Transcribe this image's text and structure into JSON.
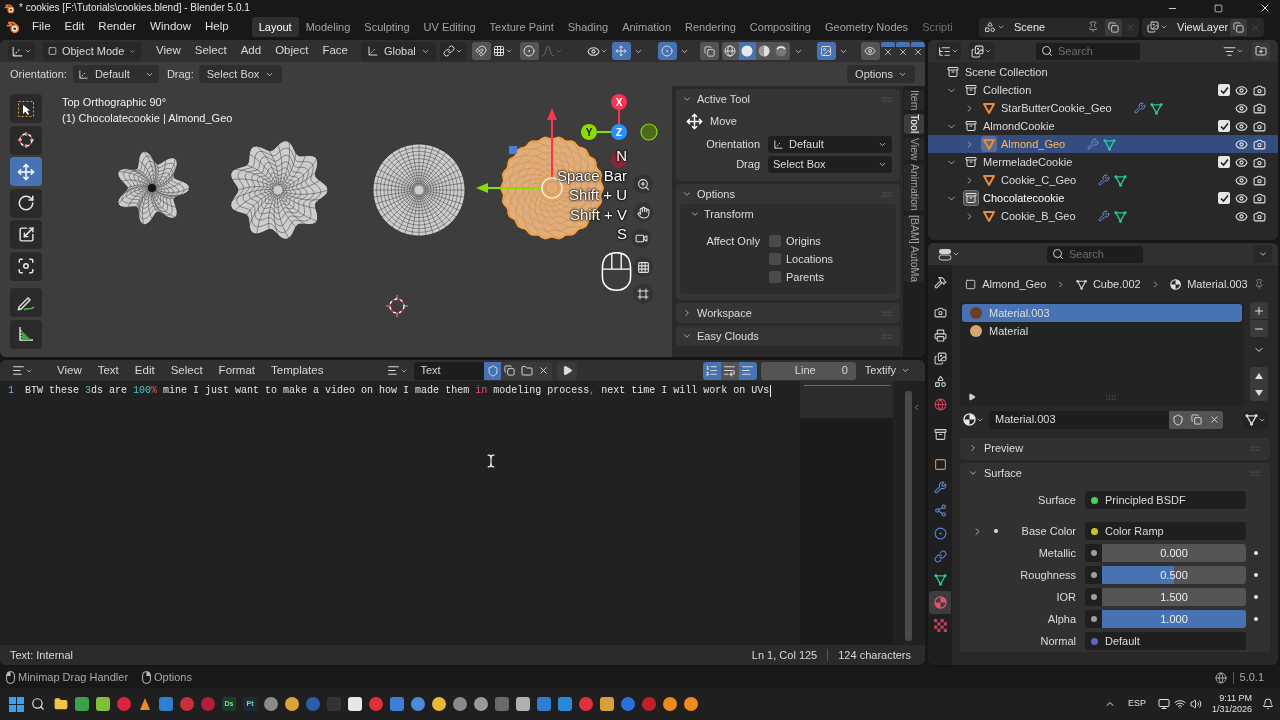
{
  "window": {
    "title": "* cookies [F:\\Tutorials\\cookies.blend] - Blender 5.0.1"
  },
  "menu": [
    "File",
    "Edit",
    "Render",
    "Window",
    "Help"
  ],
  "workspaces": [
    {
      "label": "Layout",
      "selected": true
    },
    {
      "label": "Modeling",
      "selected": false
    },
    {
      "label": "Sculpting",
      "selected": false
    },
    {
      "label": "UV Editing",
      "selected": false
    },
    {
      "label": "Texture Paint",
      "selected": false
    },
    {
      "label": "Shading",
      "selected": false
    },
    {
      "label": "Animation",
      "selected": false
    },
    {
      "label": "Rendering",
      "selected": false
    },
    {
      "label": "Compositing",
      "selected": false
    },
    {
      "label": "Geometry Nodes",
      "selected": false
    },
    {
      "label": "Scripti",
      "selected": false
    }
  ],
  "scene": {
    "name": "Scene"
  },
  "view_layer": {
    "name": "ViewLayer"
  },
  "viewport": {
    "mode": "Object Mode",
    "menus": [
      "View",
      "Select",
      "Add",
      "Object",
      "Face"
    ],
    "transform_orientation": "Global",
    "toggles": [
      {
        "kind": "snap",
        "on": false
      },
      {
        "kind": "proportional",
        "on": false
      },
      {
        "kind": "gizmos",
        "on": true
      },
      {
        "kind": "overlays",
        "on": true
      },
      {
        "kind": "xray",
        "on": false
      },
      {
        "kind": "image",
        "on": true
      },
      {
        "kind": "visibility",
        "on": false
      }
    ],
    "shading": [
      {
        "kind": "wireframe",
        "selected": false
      },
      {
        "kind": "solid",
        "selected": true
      },
      {
        "kind": "material",
        "selected": false
      },
      {
        "kind": "rendered",
        "selected": false
      }
    ],
    "tool_settings": {
      "orientation_label": "Orientation:",
      "orientation": "Default",
      "drag_label": "Drag:",
      "drag": "Select Box",
      "options": "Options"
    },
    "tools": [
      {
        "kind": "select",
        "selected": false
      },
      {
        "kind": "cursor",
        "selected": false
      },
      {
        "kind": "move",
        "selected": true
      },
      {
        "kind": "rotate",
        "selected": false
      },
      {
        "kind": "scale",
        "selected": false
      },
      {
        "kind": "transform",
        "selected": false
      },
      {
        "kind": "annotate",
        "selected": false
      },
      {
        "kind": "measure",
        "selected": false
      }
    ],
    "overlay_text": [
      "Top Orthographic 90°",
      "(1) Chocolatecookie | Almond_Geo"
    ],
    "objects": [
      {
        "kind": "star",
        "selected": false
      },
      {
        "kind": "wavy",
        "selected": false
      },
      {
        "kind": "round",
        "selected": false
      },
      {
        "kind": "swirl",
        "selected": true
      }
    ],
    "axes": [
      "X",
      "Y",
      "Z"
    ],
    "keys": [
      "N",
      "Space Bar",
      "Shift + U",
      "Shift + V",
      "S"
    ],
    "sidebar": {
      "tabs": [
        {
          "label": "Item",
          "selected": false
        },
        {
          "label": "Tool",
          "selected": true
        },
        {
          "label": "View",
          "selected": false
        },
        {
          "label": "Animation",
          "selected": false
        },
        {
          "label": "[BAM] AutoMa",
          "selected": false
        }
      ],
      "panels": [
        {
          "kind": "active_tool",
          "title": "Active Tool",
          "expanded": true,
          "tool": "Move",
          "fields": [
            {
              "label": "Orientation",
              "value": "Default"
            },
            {
              "label": "Drag",
              "value": "Select Box"
            }
          ]
        },
        {
          "kind": "options",
          "title": "Options",
          "expanded": true,
          "subpanel": {
            "title": "Transform",
            "expanded": true,
            "label": "Affect Only",
            "checks": [
              {
                "label": "Origins",
                "checked": false
              },
              {
                "label": "Locations",
                "checked": false
              },
              {
                "label": "Parents",
                "checked": false
              }
            ]
          }
        },
        {
          "kind": "plain",
          "title": "Workspace",
          "expanded": false
        },
        {
          "kind": "plain",
          "title": "Easy Clouds",
          "expanded": true
        }
      ]
    }
  },
  "text_editor": {
    "menus": [
      "View",
      "Text",
      "Edit",
      "Select",
      "Format",
      "Templates"
    ],
    "datablock": "Text",
    "fake_user": true,
    "view_toggles": [
      {
        "kind": "line_numbers",
        "on": true
      },
      {
        "kind": "word_wrap",
        "on": false
      },
      {
        "kind": "syntax",
        "on": true
      }
    ],
    "line_label": "Line",
    "line_value": "0",
    "addon_menu": "Textify",
    "lines": [
      {
        "number": "1",
        "segments": [
          {
            "kind": "plain",
            "text": "BTW these "
          },
          {
            "kind": "number",
            "text": "3"
          },
          {
            "kind": "plain",
            "text": "ds are "
          },
          {
            "kind": "number",
            "text": "100"
          },
          {
            "kind": "operator",
            "text": "%"
          },
          {
            "kind": "plain",
            "text": " mine I just want to make a video on how I made them "
          },
          {
            "kind": "keyword",
            "text": "in"
          },
          {
            "kind": "plain",
            "text": " modeling process"
          },
          {
            "kind": "operator",
            "text": ","
          },
          {
            "kind": "plain",
            "text": " next time I will work on UVs"
          }
        ]
      }
    ],
    "footer": {
      "source": "Text: Internal",
      "position": "Ln 1, Col 125",
      "count": "124 characters"
    }
  },
  "outliner": {
    "search_placeholder": "Search",
    "tree": [
      {
        "kind": "scene",
        "name": "Scene Collection",
        "children": [
          {
            "kind": "collection",
            "name": "Collection",
            "expanded": true,
            "active": false,
            "included": true,
            "children": [
              {
                "kind": "object",
                "name": "StarButterCookie_Geo",
                "expanded": false,
                "selected": false
              }
            ]
          },
          {
            "kind": "collection",
            "name": "AlmondCookie",
            "expanded": true,
            "active": false,
            "included": true,
            "children": [
              {
                "kind": "object",
                "name": "Almond_Geo",
                "expanded": false,
                "selected": true
              }
            ]
          },
          {
            "kind": "collection",
            "name": "MermeladeCookie",
            "expanded": true,
            "active": false,
            "included": true,
            "children": [
              {
                "kind": "object",
                "name": "Cookie_C_Geo",
                "expanded": false,
                "selected": false
              }
            ]
          },
          {
            "kind": "collection",
            "name": "Chocolatecookie",
            "expanded": true,
            "active": true,
            "included": true,
            "children": [
              {
                "kind": "object",
                "name": "Cookie_B_Geo",
                "expanded": false,
                "selected": false
              }
            ]
          }
        ]
      }
    ]
  },
  "properties": {
    "search_placeholder": "Search",
    "tabs": [
      {
        "kind": "tool",
        "selected": false
      },
      {
        "kind": "render",
        "selected": false
      },
      {
        "kind": "output",
        "selected": false
      },
      {
        "kind": "view_layer",
        "selected": false
      },
      {
        "kind": "scene",
        "selected": false
      },
      {
        "kind": "world",
        "selected": false
      },
      {
        "kind": "collection",
        "selected": false
      },
      {
        "kind": "object",
        "selected": false
      },
      {
        "kind": "modifiers",
        "selected": false
      },
      {
        "kind": "particles",
        "selected": false
      },
      {
        "kind": "physics",
        "selected": false
      },
      {
        "kind": "constraints",
        "selected": false
      },
      {
        "kind": "data",
        "selected": false
      },
      {
        "kind": "material",
        "selected": true
      },
      {
        "kind": "texture",
        "selected": false
      }
    ],
    "breadcrumb": [
      {
        "kind": "object",
        "label": "Almond_Geo"
      },
      {
        "kind": "mesh",
        "label": "Cube.002"
      },
      {
        "kind": "material",
        "label": "Material.003"
      }
    ],
    "slots": [
      {
        "name": "Material.003",
        "selected": true,
        "color": "#6b3f22"
      },
      {
        "name": "Material",
        "selected": false,
        "color": "#d8a570"
      }
    ],
    "material_name": "Material.003",
    "panels": [
      {
        "title": "Preview",
        "expanded": false
      },
      {
        "title": "Surface",
        "expanded": true
      }
    ],
    "inputs": [
      {
        "kind": "link",
        "label": "Surface",
        "value": "Principled BSDF",
        "color": "#4fcf5a"
      },
      {
        "kind": "link",
        "label": "Base Color",
        "value": "Color Ramp",
        "color": "#c7c729",
        "expanded": false
      },
      {
        "kind": "slider",
        "label": "Metallic",
        "value": "0.000",
        "level": 0
      },
      {
        "kind": "slider",
        "label": "Roughness",
        "value": "0.500",
        "level": 0.5
      },
      {
        "kind": "number",
        "label": "IOR",
        "value": "1.500"
      },
      {
        "kind": "slider",
        "label": "Alpha",
        "value": "1.000",
        "level": 1
      },
      {
        "kind": "link",
        "label": "Normal",
        "value": "Default",
        "color": "#6363c7"
      }
    ]
  },
  "status_bar": {
    "hints": [
      {
        "kind": "left_click",
        "label": "Minimap Drag Handler"
      },
      {
        "kind": "right_click",
        "label": "Options"
      }
    ],
    "version": "5.0.1"
  },
  "taskbar": {
    "badges": [
      "Ds",
      "Pt"
    ],
    "language": "ESP",
    "time": "9:11 PM",
    "date": "1/31/2026"
  }
}
